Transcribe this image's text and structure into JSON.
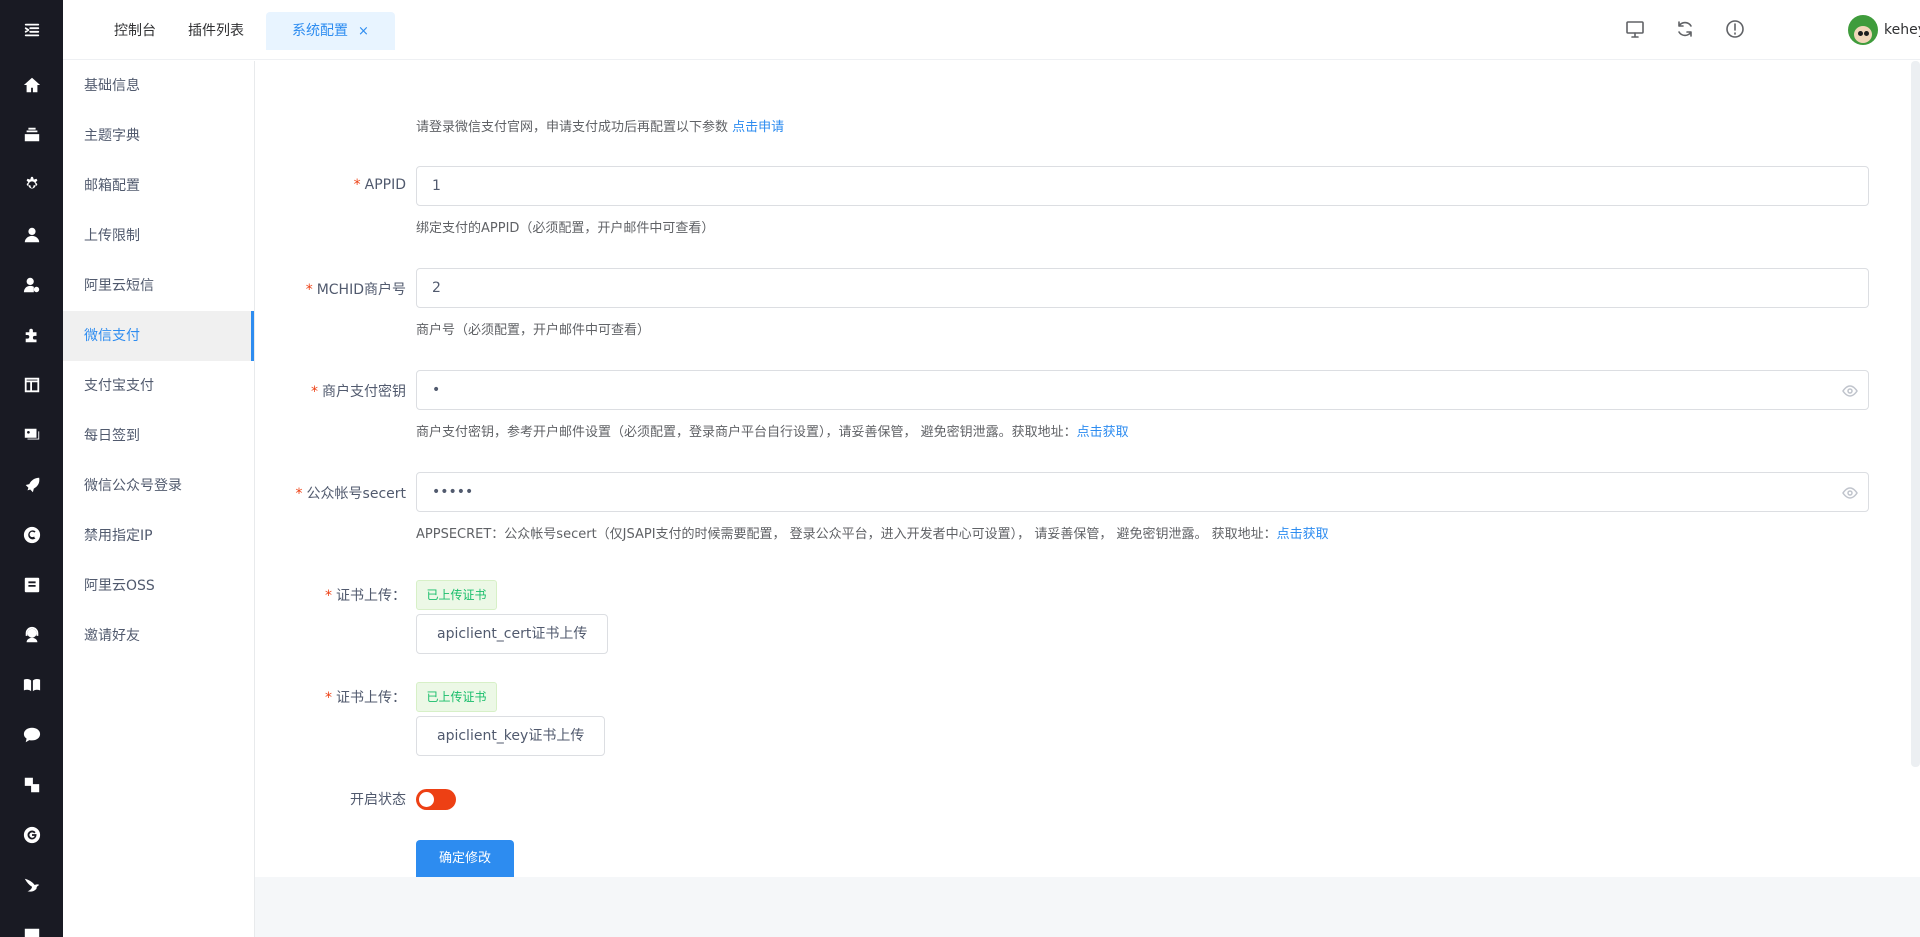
{
  "tabs": [
    {
      "label": "控制台"
    },
    {
      "label": "插件列表"
    },
    {
      "label": "系统配置",
      "close": "×"
    }
  ],
  "user": {
    "name": "keheying"
  },
  "sidebar": {
    "items": [
      {
        "label": "基础信息"
      },
      {
        "label": "主题字典"
      },
      {
        "label": "邮箱配置"
      },
      {
        "label": "上传限制"
      },
      {
        "label": "阿里云短信"
      },
      {
        "label": "微信支付"
      },
      {
        "label": "支付宝支付"
      },
      {
        "label": "每日签到"
      },
      {
        "label": "微信公众号登录"
      },
      {
        "label": "禁用指定IP"
      },
      {
        "label": "阿里云OSS"
      },
      {
        "label": "邀请好友"
      }
    ],
    "active_index": 5
  },
  "form": {
    "intro": "请登录微信支付官网，申请支付成功后再配置以下参数",
    "intro_link": "点击申请",
    "appid": {
      "label": "APPID",
      "value": "1",
      "help": "绑定支付的APPID（必须配置，开户邮件中可查看）"
    },
    "mchid": {
      "label": "MCHID商户号",
      "value": "2",
      "help": "商户号（必须配置，开户邮件中可查看）"
    },
    "key": {
      "label": "商户支付密钥",
      "value": "•",
      "help": "商户支付密钥，参考开户邮件设置（必须配置，登录商户平台自行设置），请妥善保管， 避免密钥泄露。获取地址：",
      "help_link": "点击获取"
    },
    "secret": {
      "label": "公众帐号secert",
      "value": "•••••",
      "help": "APPSECRET：公众帐号secert（仅JSAPI支付的时候需要配置， 登录公众平台，进入开发者中心可设置）， 请妥善保管， 避免密钥泄露。 获取地址：",
      "help_link": "点击获取"
    },
    "cert1": {
      "label": "证书上传：",
      "status": "已上传证书",
      "button": "apiclient_cert证书上传"
    },
    "cert2": {
      "label": "证书上传：",
      "status": "已上传证书",
      "button": "apiclient_key证书上传"
    },
    "status": {
      "label": "开启状态",
      "enabled": false
    },
    "submit": "确定修改"
  },
  "required_mark": "*",
  "icons": {
    "rail": [
      "menu-toggle-icon",
      "home-icon",
      "layers-icon",
      "gear-icon",
      "user-icon",
      "user-settings-icon",
      "puzzle-icon",
      "layout-icon",
      "gallery-icon",
      "rocket-icon",
      "copyright-icon",
      "book-square-icon",
      "support-icon",
      "reader-icon",
      "chat-icon",
      "translate-icon",
      "circle-g-icon",
      "bird-icon",
      "message-icon"
    ],
    "top": [
      "monitor-icon",
      "refresh-icon",
      "info-icon"
    ]
  },
  "colors": {
    "primary": "#2d8cf0",
    "danger": "#ed4014",
    "success": "#19be6b",
    "rail_bg": "#191a23"
  }
}
